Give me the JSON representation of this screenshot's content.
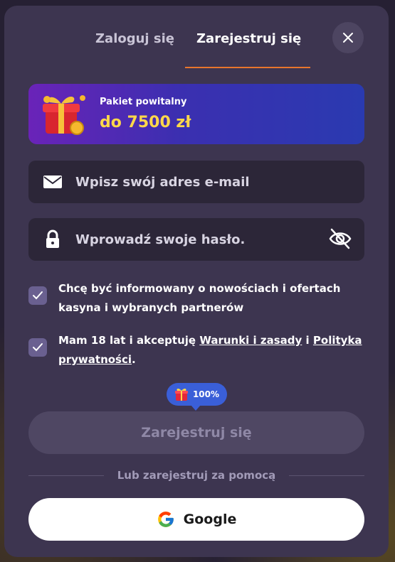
{
  "tabs": {
    "login": "Zaloguj się",
    "register": "Zarejestruj się"
  },
  "banner": {
    "title": "Pakiet powitalny",
    "amount": "do 7500 zł"
  },
  "email": {
    "placeholder": "Wpisz swój adres e-mail"
  },
  "password": {
    "placeholder": "Wprowadź swoje hasło."
  },
  "consents": {
    "marketing": "Chcę być informowany o nowościach i ofertach kasyna i wybranych partnerów",
    "terms_prefix": "Mam 18 lat i akceptuję ",
    "terms_link": "Warunki i zasady",
    "terms_middle": " i ",
    "privacy_link": "Polityka prywatności",
    "terms_suffix": "."
  },
  "bonus_tag": "100%",
  "register_button": "Zarejestruj się",
  "divider_text": "Lub zarejestruj za pomocą",
  "google_button": "Google",
  "icons": {
    "close": "close-icon",
    "gift": "gift-icon",
    "email": "envelope-icon",
    "lock": "lock-icon",
    "eye": "eye-off-icon",
    "check": "checkmark-icon",
    "google": "google-logo-icon"
  },
  "colors": {
    "accent": "#e8762c",
    "gold": "#ffd84a",
    "tag": "#3a5fd8",
    "modal": "#3d3550"
  }
}
